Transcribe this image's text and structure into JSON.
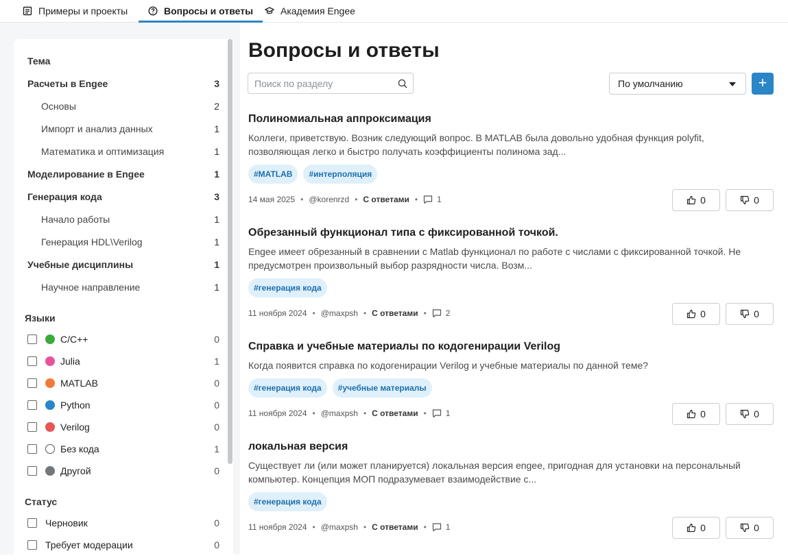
{
  "tabs": [
    {
      "label": "Примеры и проекты",
      "icon": "document-icon",
      "active": false
    },
    {
      "label": "Вопросы и ответы",
      "icon": "question-circle-icon",
      "active": true
    },
    {
      "label": "Академия Engee",
      "icon": "graduation-cap-icon",
      "active": false
    }
  ],
  "sidebar": {
    "topic_heading": "Тема",
    "topics": [
      {
        "label": "Расчеты в Engee",
        "count": "3",
        "level": 0
      },
      {
        "label": "Основы",
        "count": "2",
        "level": 1
      },
      {
        "label": "Импорт и анализ данных",
        "count": "1",
        "level": 1
      },
      {
        "label": "Математика и оптимизация",
        "count": "1",
        "level": 1
      },
      {
        "label": "Моделирование в Engee",
        "count": "1",
        "level": 0
      },
      {
        "label": "Генерация кода",
        "count": "3",
        "level": 0
      },
      {
        "label": "Начало работы",
        "count": "1",
        "level": 1
      },
      {
        "label": "Генерация HDL\\Verilog",
        "count": "1",
        "level": 1
      },
      {
        "label": "Учебные дисциплины",
        "count": "1",
        "level": 0
      },
      {
        "label": "Научное направление",
        "count": "1",
        "level": 1
      }
    ],
    "languages_heading": "Языки",
    "languages": [
      {
        "label": "C/C++",
        "count": "0",
        "color": "#3aaa3a"
      },
      {
        "label": "Julia",
        "count": "1",
        "color": "#e8529b"
      },
      {
        "label": "MATLAB",
        "count": "0",
        "color": "#f07a3a"
      },
      {
        "label": "Python",
        "count": "0",
        "color": "#2a86c6"
      },
      {
        "label": "Verilog",
        "count": "0",
        "color": "#e85555"
      },
      {
        "label": "Без кода",
        "count": "1",
        "color": "#ffffff"
      },
      {
        "label": "Другой",
        "count": "0",
        "color": "#73777c"
      }
    ],
    "status_heading": "Статус",
    "statuses": [
      {
        "label": "Черновик",
        "count": "0"
      },
      {
        "label": "Требует модерации",
        "count": "0"
      }
    ]
  },
  "main": {
    "title": "Вопросы и ответы",
    "search_placeholder": "Поиск по разделу",
    "sort_value": "По умолчанию",
    "add_label": "+"
  },
  "posts": [
    {
      "title": "Полиномиальная аппроксимация",
      "excerpt": "Коллеги, приветствую. Возник следующий вопрос. В MATLAB была довольно удобная функция polyfit, позволяющая легко и быстро получать коэффициенты полинома зад...",
      "tags": [
        "#MATLAB",
        "#интерполяция"
      ],
      "date": "14 мая 2025",
      "author": "@korenrzd",
      "status": "С ответами",
      "comments": "1",
      "likes": "0",
      "dislikes": "0"
    },
    {
      "title": "Обрезанный функционал типа с фиксированной точкой.",
      "excerpt": "Engee имеет обрезанный в сравнении с Matlab функционал по работе с числами с фиксированной точкой. Не предусмотрен произвольный выбор разрядности числа. Возм...",
      "tags": [
        "#генерация кода"
      ],
      "date": "11 ноября 2024",
      "author": "@maxpsh",
      "status": "С ответами",
      "comments": "2",
      "likes": "0",
      "dislikes": "0"
    },
    {
      "title": "Справка и учебные материалы по кодогенирации Verilog",
      "excerpt": "Когда появится справка по кодогенирации Verilog и учебные материалы по данной теме?",
      "tags": [
        "#генерация кода",
        "#учебные материалы"
      ],
      "date": "11 ноября 2024",
      "author": "@maxpsh",
      "status": "С ответами",
      "comments": "1",
      "likes": "0",
      "dislikes": "0"
    },
    {
      "title": "локальная версия",
      "excerpt": "Существует ли (или может планируется) локальная версия engee, пригодная для установки на персональный компьютер. Концепция МОП подразумевает взаимодействие с...",
      "tags": [
        "#генерация кода"
      ],
      "date": "11 ноября 2024",
      "author": "@maxpsh",
      "status": "С ответами",
      "comments": "1",
      "likes": "0",
      "dislikes": "0"
    }
  ]
}
